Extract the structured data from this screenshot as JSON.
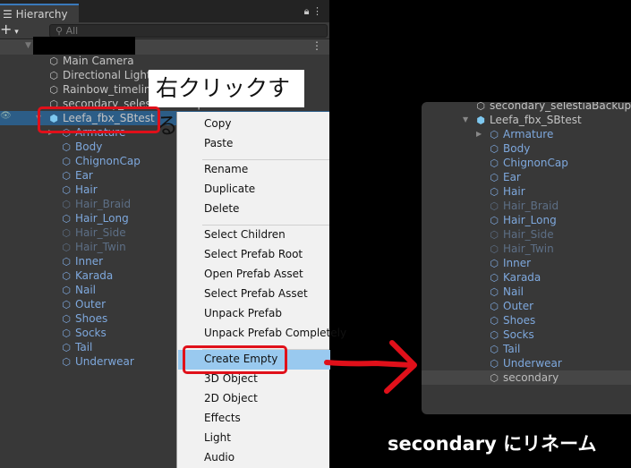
{
  "hierarchy": {
    "tab_label": "Hierarchy",
    "search_placeholder": "All",
    "icons": {
      "menu": "list-icon",
      "lock": "lock-icon",
      "more": "more-icon",
      "add": "plus-icon"
    },
    "rows": [
      {
        "label": "Main Camera",
        "type": "top"
      },
      {
        "label": "Directional Light",
        "type": "top"
      },
      {
        "label": "Rainbow_timeline",
        "type": "top"
      },
      {
        "label": "secondary_selestiaBackup",
        "type": "top"
      },
      {
        "label": "Leefa_fbx_SBtest",
        "type": "root"
      },
      {
        "label": "Armature",
        "type": "child",
        "expandable": true
      },
      {
        "label": "Body",
        "type": "child"
      },
      {
        "label": "ChignonCap",
        "type": "child"
      },
      {
        "label": "Ear",
        "type": "child"
      },
      {
        "label": "Hair",
        "type": "child"
      },
      {
        "label": "Hair_Braid",
        "type": "dim"
      },
      {
        "label": "Hair_Long",
        "type": "child"
      },
      {
        "label": "Hair_Side",
        "type": "dim"
      },
      {
        "label": "Hair_Twin",
        "type": "dim"
      },
      {
        "label": "Inner",
        "type": "child"
      },
      {
        "label": "Karada",
        "type": "child"
      },
      {
        "label": "Nail",
        "type": "child"
      },
      {
        "label": "Outer",
        "type": "child"
      },
      {
        "label": "Shoes",
        "type": "child"
      },
      {
        "label": "Socks",
        "type": "child"
      },
      {
        "label": "Tail",
        "type": "child"
      },
      {
        "label": "Underwear",
        "type": "child"
      }
    ]
  },
  "context_menu": {
    "items": [
      {
        "label": "Copy"
      },
      {
        "label": "Paste"
      },
      {
        "sep": true
      },
      {
        "label": "Rename"
      },
      {
        "label": "Duplicate"
      },
      {
        "label": "Delete"
      },
      {
        "sep": true
      },
      {
        "label": "Select Children"
      },
      {
        "label": "Select Prefab Root"
      },
      {
        "label": "Open Prefab Asset"
      },
      {
        "label": "Select Prefab Asset"
      },
      {
        "label": "Unpack Prefab"
      },
      {
        "label": "Unpack Prefab Completely"
      },
      {
        "sep": true
      },
      {
        "label": "Create Empty",
        "highlighted": true
      },
      {
        "label": "3D Object"
      },
      {
        "label": "2D Object"
      },
      {
        "label": "Effects"
      },
      {
        "label": "Light"
      },
      {
        "label": "Audio"
      }
    ]
  },
  "annotations": {
    "callout": "右クリックする",
    "caption": "secondary にリネーム",
    "accent": "#e0101a"
  },
  "result_hierarchy": {
    "rows": [
      {
        "label": "secondary_selestiaBackup",
        "type": "top"
      },
      {
        "label": "Leefa_fbx_SBtest",
        "type": "root"
      },
      {
        "label": "Armature",
        "type": "child",
        "expandable": true
      },
      {
        "label": "Body",
        "type": "child"
      },
      {
        "label": "ChignonCap",
        "type": "child"
      },
      {
        "label": "Ear",
        "type": "child"
      },
      {
        "label": "Hair",
        "type": "child"
      },
      {
        "label": "Hair_Braid",
        "type": "dim"
      },
      {
        "label": "Hair_Long",
        "type": "child"
      },
      {
        "label": "Hair_Side",
        "type": "dim"
      },
      {
        "label": "Hair_Twin",
        "type": "dim"
      },
      {
        "label": "Inner",
        "type": "child"
      },
      {
        "label": "Karada",
        "type": "child"
      },
      {
        "label": "Nail",
        "type": "child"
      },
      {
        "label": "Outer",
        "type": "child"
      },
      {
        "label": "Shoes",
        "type": "child"
      },
      {
        "label": "Socks",
        "type": "child"
      },
      {
        "label": "Tail",
        "type": "child"
      },
      {
        "label": "Underwear",
        "type": "child"
      },
      {
        "label": "secondary",
        "type": "gray"
      }
    ]
  }
}
